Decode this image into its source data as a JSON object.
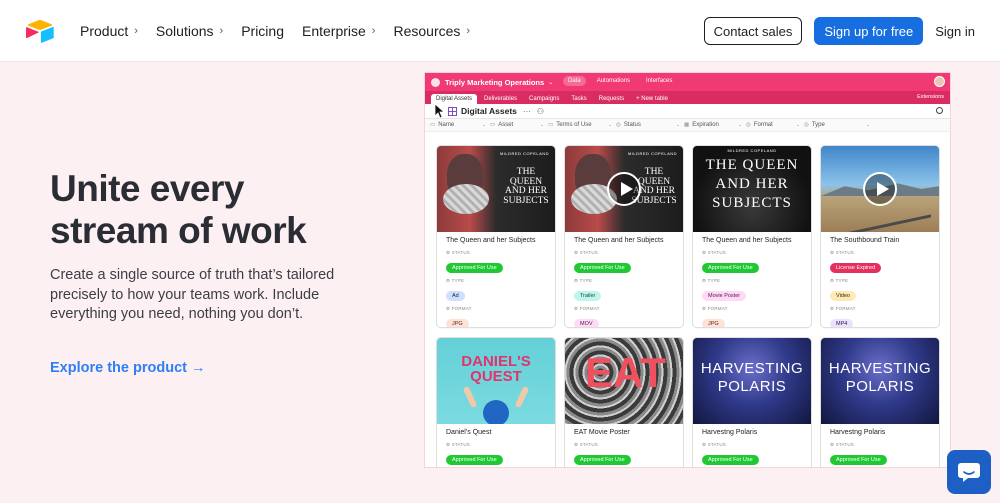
{
  "nav": {
    "items": [
      {
        "label": "Product",
        "has_menu": true
      },
      {
        "label": "Solutions",
        "has_menu": true
      },
      {
        "label": "Pricing",
        "has_menu": false
      },
      {
        "label": "Enterprise",
        "has_menu": true
      },
      {
        "label": "Resources",
        "has_menu": true
      }
    ],
    "contact_sales": "Contact sales",
    "signup": "Sign up for free",
    "signin": "Sign in"
  },
  "hero": {
    "title": "Unite every stream of work",
    "subtitle": "Create a single source of truth that’s tailored precisely to how your teams work. Include everything you need, nothing you don’t.",
    "link": "Explore the product →"
  },
  "app": {
    "base_name": "Triply Marketing Operations",
    "top_tabs": [
      "Data",
      "Automations",
      "Interfaces"
    ],
    "tables": [
      "Digital Assets",
      "Deliverables",
      "Campaigns",
      "Tasks",
      "Requests",
      "+ New table"
    ],
    "extensions": "Extensions",
    "view_name": "Digital Assets",
    "fields": [
      "Name",
      "Asset",
      "Terms of Use",
      "Status",
      "Expiration",
      "Format",
      "Type"
    ],
    "labels": {
      "status": "STATUS",
      "type": "TYPE",
      "format": "FORMAT"
    },
    "cards": [
      {
        "title": "The Queen and her Subjects",
        "status": "Approved For Use",
        "type": "Ad",
        "format": "JPG"
      },
      {
        "title": "The Queen and her Subjects",
        "status": "Approved For Use",
        "type": "Trailer",
        "format": "MOV"
      },
      {
        "title": "The Queen and her Subjects",
        "status": "Approved For Use",
        "type": "Movie Poster",
        "format": "JPG"
      },
      {
        "title": "The Southbound Train",
        "status": "License Expired",
        "type": "Video",
        "format": "MP4"
      },
      {
        "title": "Daniel’s Quest",
        "status": "Approved For Use"
      },
      {
        "title": "EAT Movie Poster",
        "status": "Approved For Use"
      },
      {
        "title": "Harvestng Polaris",
        "status": "Approved For Use"
      },
      {
        "title": "Harvestng Polaris",
        "status": "Approved For Use"
      }
    ],
    "thumbs": {
      "queen_author": "MILDRED COPELAND",
      "queen_title": "THE QUEEN AND HER SUBJECTS",
      "daniel_title": "DANIEL'S QUEST",
      "eat_title": "EAT",
      "harvest_title": "HARVESTING POLARIS"
    }
  },
  "colors": {
    "accent": "#166ee1",
    "link": "#2d7ff9",
    "app_header": "#f13a73",
    "approved": "#20c933",
    "expired": "#e3305c"
  }
}
